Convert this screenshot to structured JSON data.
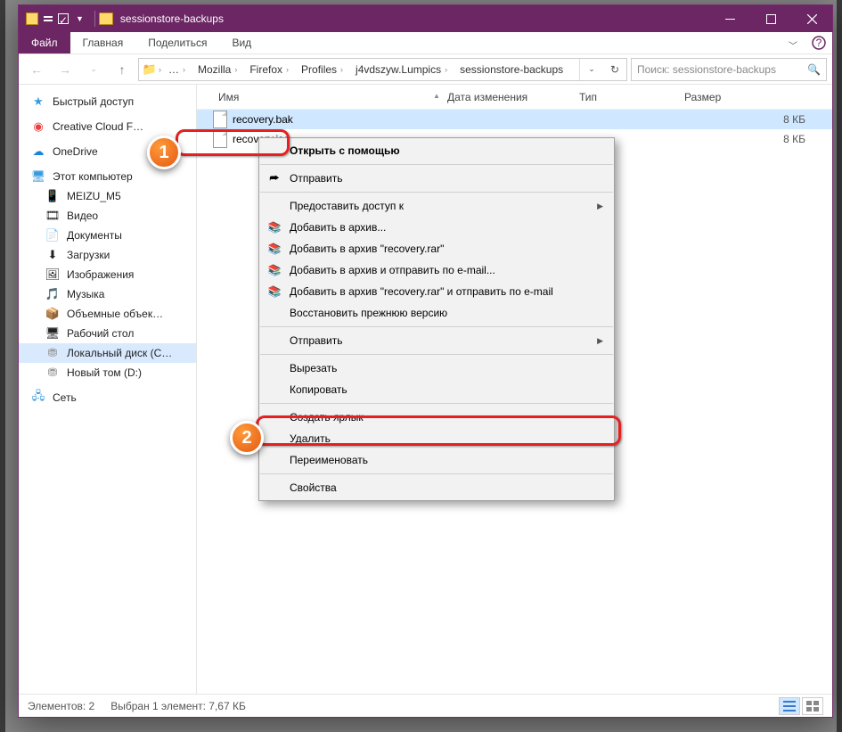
{
  "title": "sessionstore-backups",
  "ribbon": {
    "file": "Файл",
    "tabs": [
      "Главная",
      "Поделиться",
      "Вид"
    ]
  },
  "breadcrumb": {
    "items": [
      "Mozilla",
      "Firefox",
      "Profiles",
      "j4vdszyw.Lumpics",
      "sessionstore-backups"
    ]
  },
  "search": {
    "placeholder": "Поиск: sessionstore-backups"
  },
  "columns": {
    "name": "Имя",
    "date": "Дата изменения",
    "type": "Тип",
    "size": "Размер"
  },
  "sidebar": {
    "quick": "Быстрый доступ",
    "ccf": "Creative Cloud F…",
    "onedrive": "OneDrive",
    "pc": "Этот компьютер",
    "children": [
      "MEIZU_M5",
      "Видео",
      "Документы",
      "Загрузки",
      "Изображения",
      "Музыка",
      "Объемные объек…",
      "Рабочий стол",
      "Локальный диск (С…",
      "Новый том (D:)"
    ],
    "net": "Сеть"
  },
  "files": [
    {
      "name": "recovery.bak",
      "date": "",
      "type": "",
      "size": "8 КБ"
    },
    {
      "name": "recovery.jso…",
      "date": "",
      "type": "",
      "size": "8 КБ"
    }
  ],
  "ctx": {
    "open": "Открыть с помощью",
    "send": "Отправить",
    "grant": "Предоставить доступ к",
    "arch1": "Добавить в архив...",
    "arch2": "Добавить в архив \"recovery.rar\"",
    "arch3": "Добавить в архив и отправить по e-mail...",
    "arch4": "Добавить в архив \"recovery.rar\" и отправить по e-mail",
    "restore": "Восстановить прежнюю версию",
    "sendto": "Отправить",
    "cut": "Вырезать",
    "copy": "Копировать",
    "shortcut": "Создать ярлык",
    "delete": "Удалить",
    "rename": "Переименовать",
    "props": "Свойства"
  },
  "status": {
    "items": "Элементов: 2",
    "sel": "Выбран 1 элемент: 7,67 КБ"
  },
  "badges": {
    "b1": "1",
    "b2": "2"
  }
}
